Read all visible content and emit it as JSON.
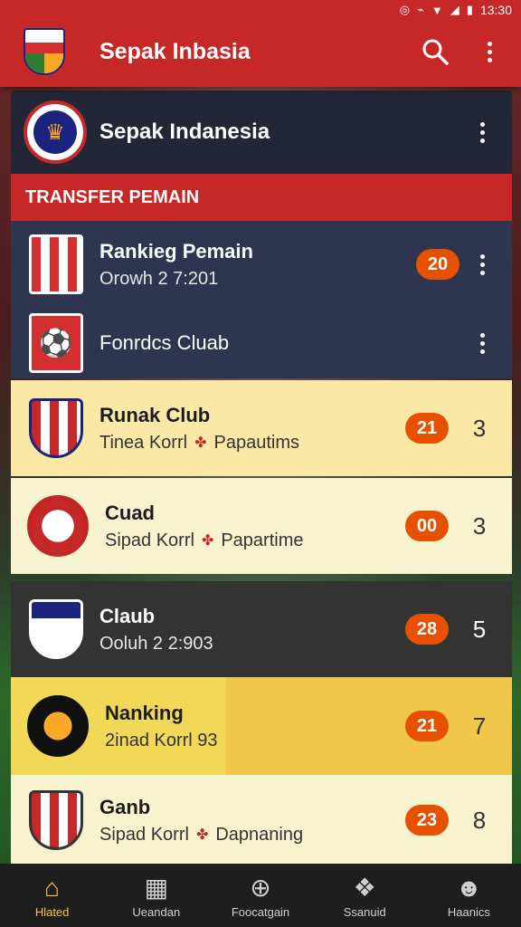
{
  "status_bar": {
    "time": "13:30"
  },
  "app_bar": {
    "title": "Sepak Inbasia"
  },
  "header_card": {
    "title": "Sepak Indanesia"
  },
  "section": {
    "title": "TRANSFER PEMAIN"
  },
  "rows": [
    {
      "title": "Rankieg Pemain",
      "subtitle": "Orowh 2 7:201",
      "score": "20",
      "rank": ""
    },
    {
      "title": "Fonrdcs Cluab",
      "subtitle": "",
      "score": "",
      "rank": ""
    },
    {
      "title": "Runak Club",
      "subtitle_a": "Tinea Korrl",
      "subtitle_b": "Papautims",
      "score": "21",
      "rank": "3"
    },
    {
      "title": "Cuad",
      "subtitle_a": "Sipad Korrl",
      "subtitle_b": "Papartime",
      "score": "00",
      "rank": "3"
    },
    {
      "title": "Claub",
      "subtitle": "Ooluh 2 2:903",
      "score": "28",
      "rank": "5"
    },
    {
      "title": "Nanking",
      "subtitle": "2inad Korrl 93",
      "score": "21",
      "rank": "7"
    },
    {
      "title": "Ganb",
      "subtitle_a": "Sipad Korrl",
      "subtitle_b": "Dapnaning",
      "score": "23",
      "rank": "8"
    }
  ],
  "bottom_nav": [
    {
      "label": "Hlated",
      "icon": "home-icon",
      "active": true
    },
    {
      "label": "Ueandan",
      "icon": "table-icon",
      "active": false
    },
    {
      "label": "Foocatgain",
      "icon": "ball-icon",
      "active": false
    },
    {
      "label": "Ssanuid",
      "icon": "team-icon",
      "active": false
    },
    {
      "label": "Haanics",
      "icon": "profile-icon",
      "active": false
    }
  ],
  "colors": {
    "primary": "#c62828",
    "navy": "#2f3550",
    "score": "#e65100",
    "active_nav": "#f9c531"
  }
}
